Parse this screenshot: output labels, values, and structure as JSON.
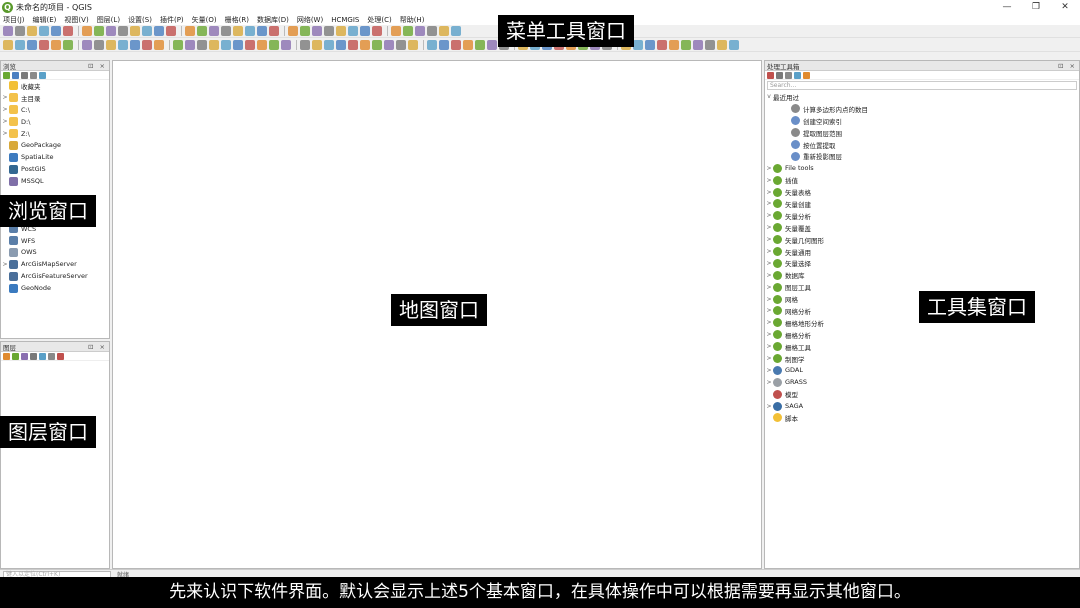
{
  "window": {
    "title": "未命名的项目 - QGIS",
    "app_icon_letter": "Q",
    "controls": {
      "minimize": "—",
      "restore": "❐",
      "close": "✕"
    }
  },
  "menubar": {
    "items": [
      "项目(J)",
      "编辑(E)",
      "视图(V)",
      "图层(L)",
      "设置(S)",
      "插件(P)",
      "矢量(O)",
      "栅格(R)",
      "数据库(D)",
      "网络(W)",
      "HCMGIS",
      "处理(C)",
      "帮助(H)"
    ]
  },
  "browser_panel": {
    "title": "浏览",
    "header_controls": "⊡ ×",
    "items": [
      {
        "label": "收藏夹",
        "arrow": "",
        "icon": "star-icon",
        "color": "#f2c037"
      },
      {
        "label": "主目录",
        "arrow": ">",
        "icon": "folder-icon",
        "color": "#f3c24b"
      },
      {
        "label": "C:\\",
        "arrow": ">",
        "icon": "folder-icon",
        "color": "#f3c24b"
      },
      {
        "label": "D:\\",
        "arrow": ">",
        "icon": "folder-icon",
        "color": "#f3c24b"
      },
      {
        "label": "Z:\\",
        "arrow": ">",
        "icon": "folder-icon",
        "color": "#f3c24b"
      },
      {
        "label": "GeoPackage",
        "arrow": "",
        "icon": "geopackage-icon",
        "color": "#d8a93a"
      },
      {
        "label": "SpatiaLite",
        "arrow": "",
        "icon": "spatialite-icon",
        "color": "#3e7bbf"
      },
      {
        "label": "PostGIS",
        "arrow": "",
        "icon": "postgis-icon",
        "color": "#336791"
      },
      {
        "label": "MSSQL",
        "arrow": "",
        "icon": "mssql-icon",
        "color": "#7f6fa8"
      },
      {
        "label": "",
        "arrow": "",
        "icon": "hidden-icon",
        "color": "#ffffff"
      },
      {
        "label": "",
        "arrow": "",
        "icon": "hidden-icon",
        "color": "#ffffff"
      },
      {
        "label": "XYZ Tiles",
        "arrow": ">",
        "icon": "xyz-tiles-icon",
        "color": "#5a8bc4"
      },
      {
        "label": "WCS",
        "arrow": "",
        "icon": "globe-icon",
        "color": "#5a7ea8"
      },
      {
        "label": "WFS",
        "arrow": "",
        "icon": "globe-icon",
        "color": "#5a7ea8"
      },
      {
        "label": "OWS",
        "arrow": "",
        "icon": "globe-icon",
        "color": "#8a9bb0"
      },
      {
        "label": "ArcGisMapServer",
        "arrow": ">",
        "icon": "arcgis-icon",
        "color": "#4a6f9a"
      },
      {
        "label": "ArcGisFeatureServer",
        "arrow": "",
        "icon": "arcgis-icon",
        "color": "#4a6f9a"
      },
      {
        "label": "GeoNode",
        "arrow": "",
        "icon": "geonode-icon",
        "color": "#3a7abf"
      }
    ]
  },
  "layers_panel": {
    "title": "图层",
    "header_controls": "⊡ ×"
  },
  "toolbox_panel": {
    "title": "处理工具箱",
    "header_controls": "⊡ ×",
    "search_placeholder": "Search...",
    "items": [
      {
        "label": "最近用过",
        "arrow": "v",
        "indent": 0,
        "icon": "none",
        "color": "#ffffff"
      },
      {
        "label": "计算多边形内点的数目",
        "arrow": "",
        "indent": 2,
        "icon": "point-count-icon",
        "color": "#8a8a8a"
      },
      {
        "label": "创建空间索引",
        "arrow": "",
        "indent": 2,
        "icon": "gear-icon",
        "color": "#6a8fc8"
      },
      {
        "label": "提取图层范围",
        "arrow": "",
        "indent": 2,
        "icon": "extent-icon",
        "color": "#8a8a8a"
      },
      {
        "label": "按位置提取",
        "arrow": "",
        "indent": 2,
        "icon": "gear-icon",
        "color": "#6a8fc8"
      },
      {
        "label": "重新投影图层",
        "arrow": "",
        "indent": 2,
        "icon": "gear-icon",
        "color": "#6a8fc8"
      },
      {
        "label": "File tools",
        "arrow": ">",
        "indent": 0,
        "icon": "qgis-icon",
        "color": "#6aa832"
      },
      {
        "label": "插值",
        "arrow": ">",
        "indent": 0,
        "icon": "qgis-icon",
        "color": "#6aa832"
      },
      {
        "label": "矢量表格",
        "arrow": ">",
        "indent": 0,
        "icon": "qgis-icon",
        "color": "#6aa832"
      },
      {
        "label": "矢量创建",
        "arrow": ">",
        "indent": 0,
        "icon": "qgis-icon",
        "color": "#6aa832"
      },
      {
        "label": "矢量分析",
        "arrow": ">",
        "indent": 0,
        "icon": "qgis-icon",
        "color": "#6aa832"
      },
      {
        "label": "矢量覆盖",
        "arrow": ">",
        "indent": 0,
        "icon": "qgis-icon",
        "color": "#6aa832"
      },
      {
        "label": "矢量几何图形",
        "arrow": ">",
        "indent": 0,
        "icon": "qgis-icon",
        "color": "#6aa832"
      },
      {
        "label": "矢量通用",
        "arrow": ">",
        "indent": 0,
        "icon": "qgis-icon",
        "color": "#6aa832"
      },
      {
        "label": "矢量选择",
        "arrow": ">",
        "indent": 0,
        "icon": "qgis-icon",
        "color": "#6aa832"
      },
      {
        "label": "数据库",
        "arrow": ">",
        "indent": 0,
        "icon": "qgis-icon",
        "color": "#6aa832"
      },
      {
        "label": "图层工具",
        "arrow": ">",
        "indent": 0,
        "icon": "qgis-icon",
        "color": "#6aa832"
      },
      {
        "label": "网格",
        "arrow": ">",
        "indent": 0,
        "icon": "qgis-icon",
        "color": "#6aa832"
      },
      {
        "label": "网络分析",
        "arrow": ">",
        "indent": 0,
        "icon": "qgis-icon",
        "color": "#6aa832"
      },
      {
        "label": "栅格地形分析",
        "arrow": ">",
        "indent": 0,
        "icon": "qgis-icon",
        "color": "#6aa832"
      },
      {
        "label": "栅格分析",
        "arrow": ">",
        "indent": 0,
        "icon": "qgis-icon",
        "color": "#6aa832"
      },
      {
        "label": "栅格工具",
        "arrow": ">",
        "indent": 0,
        "icon": "qgis-icon",
        "color": "#6aa832"
      },
      {
        "label": "制图学",
        "arrow": ">",
        "indent": 0,
        "icon": "qgis-icon",
        "color": "#6aa832"
      },
      {
        "label": "GDAL",
        "arrow": ">",
        "indent": 0,
        "icon": "gdal-icon",
        "color": "#4a7ab0"
      },
      {
        "label": "GRASS",
        "arrow": ">",
        "indent": 0,
        "icon": "grass-icon",
        "color": "#9aa0a6"
      },
      {
        "label": "模型",
        "arrow": "",
        "indent": 0,
        "icon": "model-icon",
        "color": "#c0504d"
      },
      {
        "label": "SAGA",
        "arrow": ">",
        "indent": 0,
        "icon": "saga-icon",
        "color": "#3a6ea5"
      },
      {
        "label": "脚本",
        "arrow": "",
        "indent": 0,
        "icon": "python-icon",
        "color": "#f2c037"
      }
    ]
  },
  "statusbar": {
    "search_placeholder": "键入以定位(Ctrl+K)",
    "text": "就绪"
  },
  "annotations": {
    "menu_toolbar": "菜单工具窗口",
    "browser": "浏览窗口",
    "map": "地图窗口",
    "toolbox": "工具集窗口",
    "layers": "图层窗口"
  },
  "caption": "先来认识下软件界面。默认会显示上述5个基本窗口，在具体操作中可以根据需要再显示其他窗口。",
  "colors": {
    "toolbar_icons": [
      "#4a7fc1",
      "#6aa832",
      "#d8a93a",
      "#c0504d",
      "#8a6fb0",
      "#5aa0c8",
      "#e08a2e",
      "#7a7a7a"
    ]
  }
}
